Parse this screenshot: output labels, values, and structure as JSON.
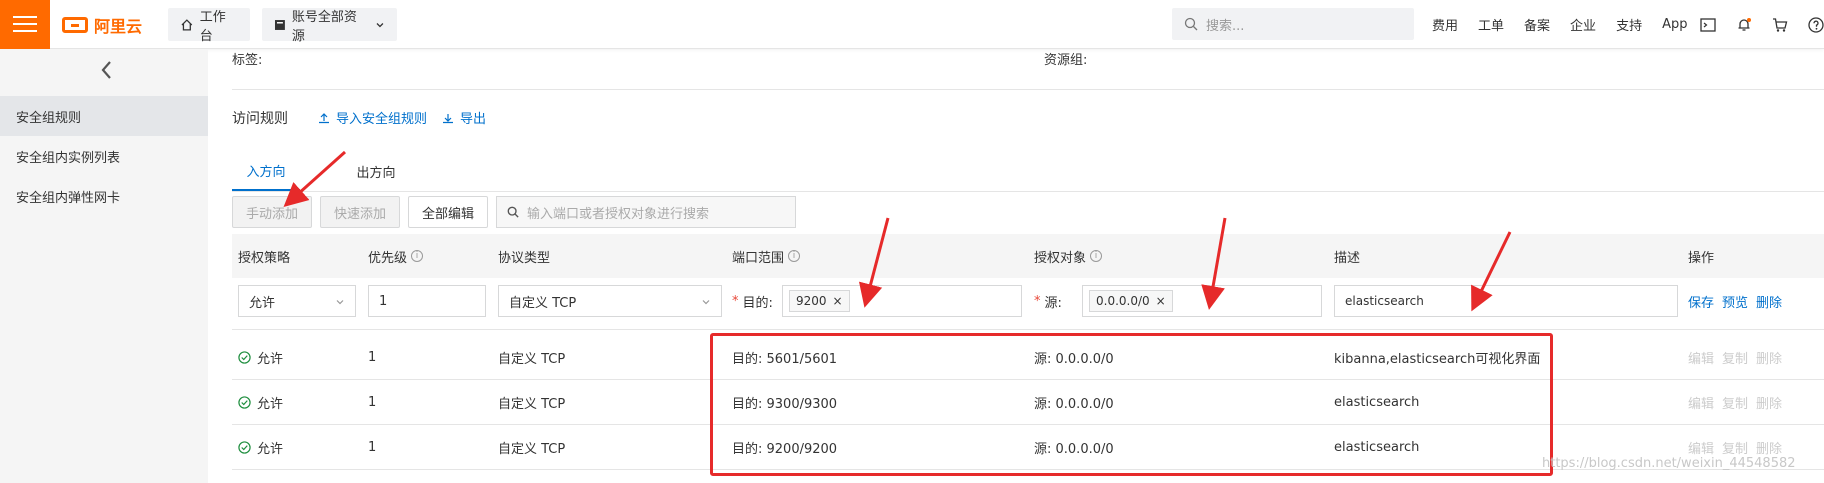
{
  "topbar": {
    "logo_text": "阿里云",
    "workbench": "工作台",
    "account_resources": "账号全部资源",
    "search_placeholder": "搜索...",
    "links": [
      "费用",
      "工单",
      "备案",
      "企业",
      "支持",
      "App"
    ],
    "accent": "#ff6a00"
  },
  "sidebar": {
    "items": [
      "安全组规则",
      "安全组内实例列表",
      "安全组内弹性网卡"
    ],
    "active_index": 0
  },
  "info": {
    "tags_label": "标签:",
    "resource_group_label": "资源组:"
  },
  "rules": {
    "title": "访问规则",
    "import_link": "导入安全组规则",
    "export_link": "导出",
    "tabs": [
      "入方向",
      "出方向"
    ],
    "active_tab": 0,
    "buttons": {
      "manual_add": "手动添加",
      "quick_add": "快速添加",
      "edit_all": "全部编辑"
    },
    "search_placeholder": "输入端口或者授权对象进行搜索",
    "columns": [
      "授权策略",
      "优先级",
      "协议类型",
      "端口范围",
      "授权对象",
      "描述",
      "操作"
    ],
    "edit_row": {
      "policy": "允许",
      "priority": "1",
      "protocol": "自定义 TCP",
      "port_label": "目的:",
      "port_tag": "9200",
      "source_label": "源:",
      "source_tag": "0.0.0.0/0",
      "description": "elasticsearch",
      "actions": [
        "保存",
        "预览",
        "删除"
      ]
    },
    "rows": [
      {
        "policy": "允许",
        "priority": "1",
        "protocol": "自定义 TCP",
        "port": "目的: 5601/5601",
        "source": "源: 0.0.0.0/0",
        "description": "kibanna,elasticsearch可视化界面"
      },
      {
        "policy": "允许",
        "priority": "1",
        "protocol": "自定义 TCP",
        "port": "目的: 9300/9300",
        "source": "源: 0.0.0.0/0",
        "description": "elasticsearch"
      },
      {
        "policy": "允许",
        "priority": "1",
        "protocol": "自定义 TCP",
        "port": "目的: 9200/9200",
        "source": "源: 0.0.0.0/0",
        "description": "elasticsearch"
      }
    ],
    "row_actions": [
      "编辑",
      "复制",
      "删除"
    ]
  },
  "watermark": "https://blog.csdn.net/weixin_44548582"
}
